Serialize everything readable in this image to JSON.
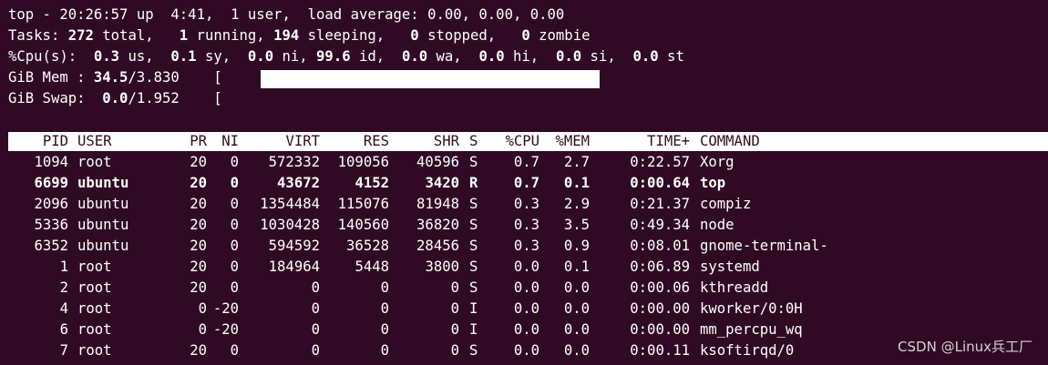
{
  "summary": {
    "l1_pre": "top - ",
    "time": "20:26:57",
    "l1_up": " up  ",
    "uptime": "4:41",
    "l1_users_sep": ",  ",
    "users": "1",
    "l1_users_word": " user,  load average: ",
    "load": "0.00, 0.00, 0.00",
    "tasks_label": "Tasks: ",
    "tasks_total": "272",
    "tasks_total_w": " total,   ",
    "tasks_running": "1",
    "tasks_running_w": " running, ",
    "tasks_sleeping": "194",
    "tasks_sleeping_w": " sleeping,   ",
    "tasks_stopped": "0",
    "tasks_stopped_w": " stopped,   ",
    "tasks_zombie": "0",
    "tasks_zombie_w": " zombie",
    "cpu_label": "%Cpu(s):  ",
    "cpu_us": "0.3",
    "cpu_us_w": " us,  ",
    "cpu_sy": "0.1",
    "cpu_sy_w": " sy,  ",
    "cpu_ni": "0.0",
    "cpu_ni_w": " ni, ",
    "cpu_id": "99.6",
    "cpu_id_w": " id,  ",
    "cpu_wa": "0.0",
    "cpu_wa_w": " wa,  ",
    "cpu_hi": "0.0",
    "cpu_hi_w": " hi,  ",
    "cpu_si": "0.0",
    "cpu_si_w": " si,  ",
    "cpu_st": "0.0",
    "cpu_st_w": " st",
    "mem_label": "GiB Mem : ",
    "mem_used": "34.5",
    "mem_total": "/3.830",
    "mem_bracket": "    [",
    "mem_fraction": 0.345,
    "swap_label": "GiB Swap:  ",
    "swap_used": "0.0",
    "swap_total": "/1.952",
    "swap_bracket": "    ["
  },
  "table": {
    "headers": [
      "PID",
      "USER",
      "PR",
      "NI",
      "VIRT",
      "RES",
      "SHR",
      "S",
      "%CPU",
      "%MEM",
      "TIME+",
      "COMMAND"
    ],
    "rows": [
      [
        "1094",
        "root",
        "20",
        "0",
        "572332",
        "109056",
        "40596",
        "S",
        "0.7",
        "2.7",
        "0:22.57",
        "Xorg"
      ],
      [
        "6699",
        "ubuntu",
        "20",
        "0",
        "43672",
        "4152",
        "3420",
        "R",
        "0.7",
        "0.1",
        "0:00.64",
        "top"
      ],
      [
        "2096",
        "ubuntu",
        "20",
        "0",
        "1354484",
        "115076",
        "81948",
        "S",
        "0.3",
        "2.9",
        "0:21.37",
        "compiz"
      ],
      [
        "5336",
        "ubuntu",
        "20",
        "0",
        "1030428",
        "140560",
        "36820",
        "S",
        "0.3",
        "3.5",
        "0:49.34",
        "node"
      ],
      [
        "6352",
        "ubuntu",
        "20",
        "0",
        "594592",
        "36528",
        "28456",
        "S",
        "0.3",
        "0.9",
        "0:08.01",
        "gnome-terminal-"
      ],
      [
        "1",
        "root",
        "20",
        "0",
        "184964",
        "5448",
        "3800",
        "S",
        "0.0",
        "0.1",
        "0:06.89",
        "systemd"
      ],
      [
        "2",
        "root",
        "20",
        "0",
        "0",
        "0",
        "0",
        "S",
        "0.0",
        "0.0",
        "0:00.06",
        "kthreadd"
      ],
      [
        "4",
        "root",
        "0",
        "-20",
        "0",
        "0",
        "0",
        "I",
        "0.0",
        "0.0",
        "0:00.00",
        "kworker/0:0H"
      ],
      [
        "6",
        "root",
        "0",
        "-20",
        "0",
        "0",
        "0",
        "I",
        "0.0",
        "0.0",
        "0:00.00",
        "mm_percpu_wq"
      ],
      [
        "7",
        "root",
        "20",
        "0",
        "0",
        "0",
        "0",
        "S",
        "0.0",
        "0.0",
        "0:00.11",
        "ksoftirqd/0"
      ]
    ],
    "bold_row": 1
  },
  "watermark": "CSDN @Linux兵工厂",
  "colors": {
    "background": "#300a24",
    "foreground": "#ffffff"
  }
}
